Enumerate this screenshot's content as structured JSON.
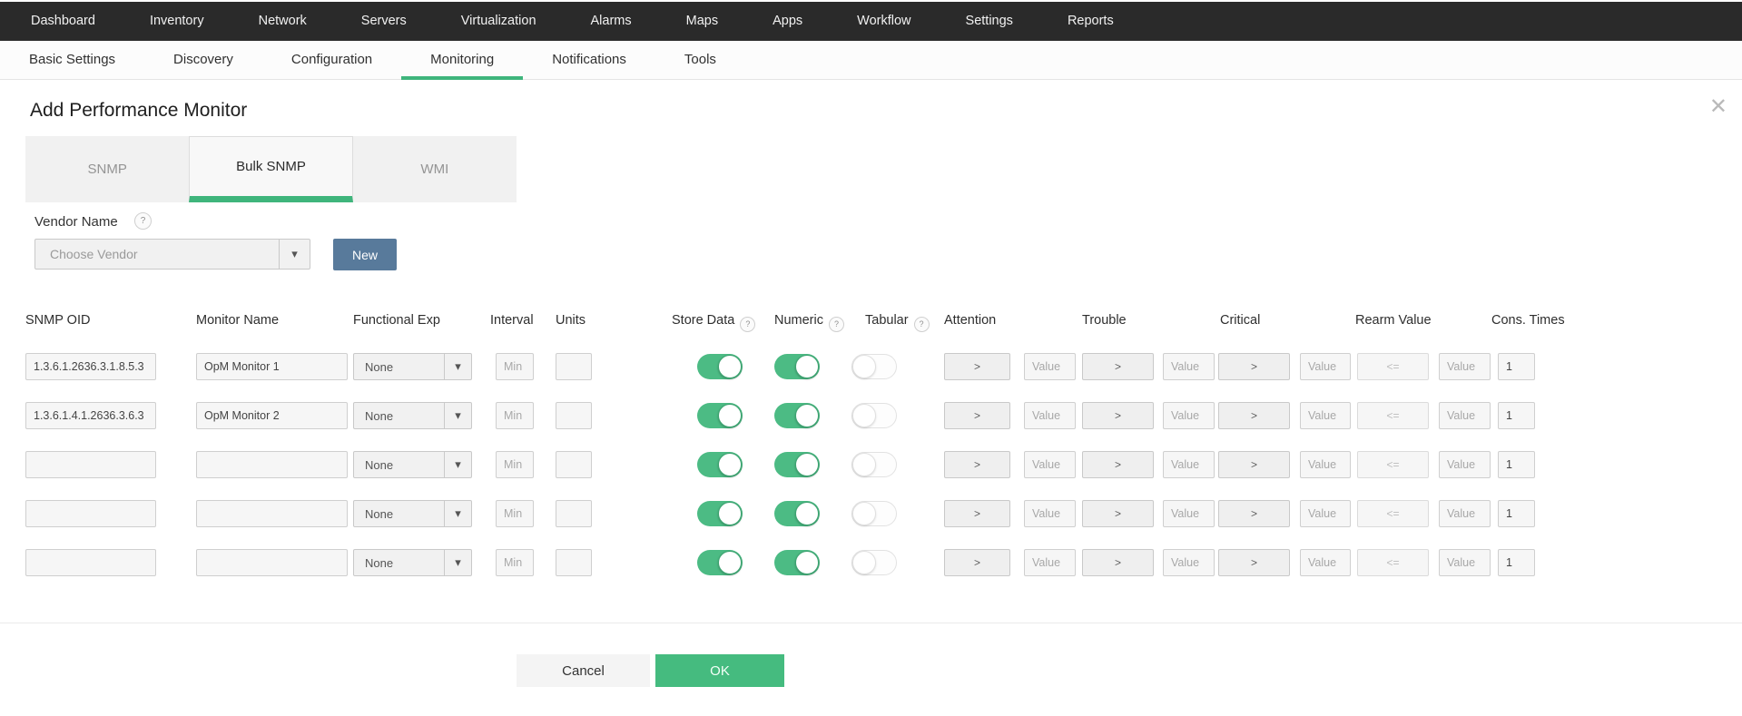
{
  "topnav": {
    "items": [
      "Dashboard",
      "Inventory",
      "Network",
      "Servers",
      "Virtualization",
      "Alarms",
      "Maps",
      "Apps",
      "Workflow",
      "Settings",
      "Reports"
    ]
  },
  "subnav": {
    "items": [
      "Basic Settings",
      "Discovery",
      "Configuration",
      "Monitoring",
      "Notifications",
      "Tools"
    ],
    "active": "Monitoring"
  },
  "panel": {
    "title": "Add Performance Monitor",
    "close_icon": "✕",
    "tabs": [
      {
        "label": "SNMP",
        "active": false
      },
      {
        "label": "Bulk SNMP",
        "active": true
      },
      {
        "label": "WMI",
        "active": false
      }
    ],
    "vendor": {
      "label": "Vendor Name",
      "help_icon": "?",
      "placeholder": "Choose Vendor",
      "dropdown_arrow_icon": "▾",
      "new_button": "New"
    },
    "table": {
      "headers": {
        "snmp_oid": "SNMP OID",
        "monitor_name": "Monitor Name",
        "functional_exp": "Functional Exp",
        "interval": "Interval",
        "units": "Units",
        "store_data": "Store Data",
        "numeric": "Numeric",
        "tabular": "Tabular",
        "attention": "Attention",
        "trouble": "Trouble",
        "critical": "Critical",
        "rearm_value": "Rearm Value",
        "cons_times": "Cons. Times",
        "help_icon": "?"
      },
      "rows": [
        {
          "snmp_oid": "1.3.6.1.2636.3.1.8.5.3",
          "monitor_name": "OpM Monitor 1",
          "functional_exp": "None",
          "interval_placeholder": "Min",
          "units_value": "",
          "store_data": true,
          "numeric": true,
          "tabular": false,
          "attention_op": ">",
          "attention_placeholder": "Value",
          "trouble_op": ">",
          "trouble_placeholder": "Value",
          "critical_op": ">",
          "critical_placeholder": "Value",
          "rearm_op": "<=",
          "rearm_placeholder": "Value",
          "cons_times": "1"
        },
        {
          "snmp_oid": "1.3.6.1.4.1.2636.3.6.3",
          "monitor_name": "OpM Monitor 2",
          "functional_exp": "None",
          "interval_placeholder": "Min",
          "units_value": "",
          "store_data": true,
          "numeric": true,
          "tabular": false,
          "attention_op": ">",
          "attention_placeholder": "Value",
          "trouble_op": ">",
          "trouble_placeholder": "Value",
          "critical_op": ">",
          "critical_placeholder": "Value",
          "rearm_op": "<=",
          "rearm_placeholder": "Value",
          "cons_times": "1"
        },
        {
          "snmp_oid": "",
          "monitor_name": "",
          "functional_exp": "None",
          "interval_placeholder": "Min",
          "units_value": "",
          "store_data": true,
          "numeric": true,
          "tabular": false,
          "attention_op": ">",
          "attention_placeholder": "Value",
          "trouble_op": ">",
          "trouble_placeholder": "Value",
          "critical_op": ">",
          "critical_placeholder": "Value",
          "rearm_op": "<=",
          "rearm_placeholder": "Value",
          "cons_times": "1"
        },
        {
          "snmp_oid": "",
          "monitor_name": "",
          "functional_exp": "None",
          "interval_placeholder": "Min",
          "units_value": "",
          "store_data": true,
          "numeric": true,
          "tabular": false,
          "attention_op": ">",
          "attention_placeholder": "Value",
          "trouble_op": ">",
          "trouble_placeholder": "Value",
          "critical_op": ">",
          "critical_placeholder": "Value",
          "rearm_op": "<=",
          "rearm_placeholder": "Value",
          "cons_times": "1"
        },
        {
          "snmp_oid": "",
          "monitor_name": "",
          "functional_exp": "None",
          "interval_placeholder": "Min",
          "units_value": "",
          "store_data": true,
          "numeric": true,
          "tabular": false,
          "attention_op": ">",
          "attention_placeholder": "Value",
          "trouble_op": ">",
          "trouble_placeholder": "Value",
          "critical_op": ">",
          "critical_placeholder": "Value",
          "rearm_op": "<=",
          "rearm_placeholder": "Value",
          "cons_times": "1"
        }
      ]
    },
    "footer": {
      "cancel": "Cancel",
      "ok": "OK"
    }
  },
  "colors": {
    "topnav_bg": "#2a2a2a",
    "accent_green": "#3fb57c",
    "toggle_green": "#4cbb84",
    "ok_green": "#45bb7f",
    "new_button_blue": "#587a9b"
  }
}
